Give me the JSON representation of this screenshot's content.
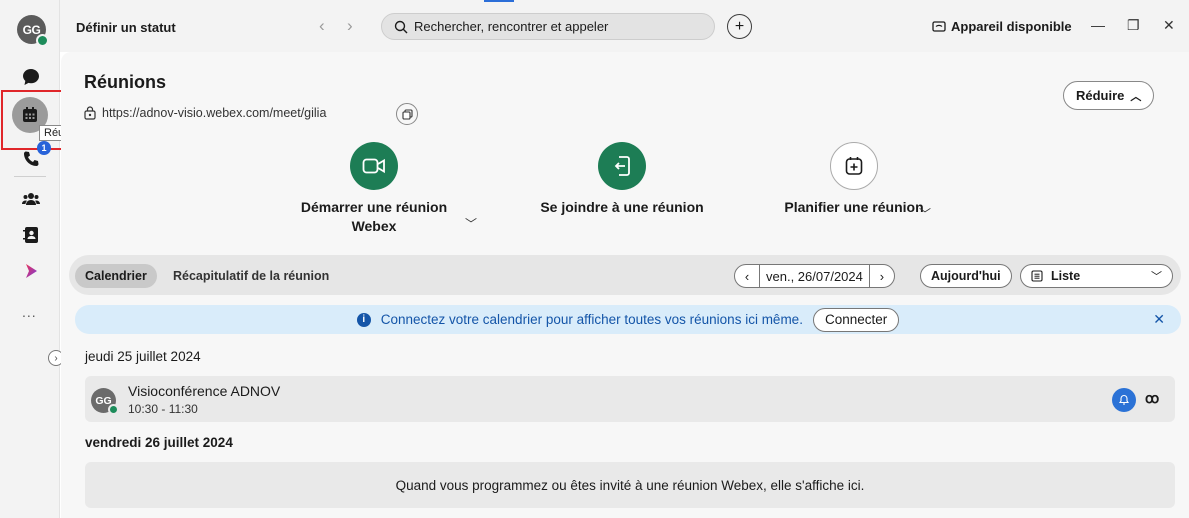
{
  "user": {
    "initials": "GG",
    "status_label": "Définir un statut"
  },
  "rail": {
    "active_tooltip": "Réunions",
    "calls_badge": "1",
    "more": "..."
  },
  "search": {
    "placeholder": "Rechercher, rencontrer et appeler"
  },
  "titlebar": {
    "device_label": "Appareil disponible"
  },
  "page": {
    "title": "Réunions",
    "meeting_url": "https://adnov-visio.webex.com/meet/gilia",
    "reduce_label": "Réduire"
  },
  "actions": {
    "start_line1": "Démarrer une réunion",
    "start_line2": "Webex",
    "join": "Se joindre à une réunion",
    "schedule": "Planifier une réunion"
  },
  "tabs": {
    "calendar": "Calendrier",
    "recap": "Récapitulatif de la réunion"
  },
  "date_nav": {
    "current_date": "ven., 26/07/2024",
    "today_label": "Aujourd'hui",
    "view_label": "Liste"
  },
  "banner": {
    "message": "Connectez votre calendrier pour afficher toutes vos réunions ici même.",
    "connect_label": "Connecter"
  },
  "days": [
    {
      "label": "jeudi 25 juillet 2024",
      "meeting": {
        "initials": "GG",
        "title": "Visioconférence ADNOV",
        "time": "10:30 - 11:30"
      }
    },
    {
      "label": "vendredi 26 juillet 2024",
      "empty_message": "Quand vous programmez ou êtes invité à une réunion Webex, elle s'affiche ici."
    }
  ],
  "colors": {
    "accent_green": "#1d7d55",
    "banner_bg": "#d9ecfa",
    "banner_text": "#1455a8",
    "highlight": "#e0262a"
  }
}
